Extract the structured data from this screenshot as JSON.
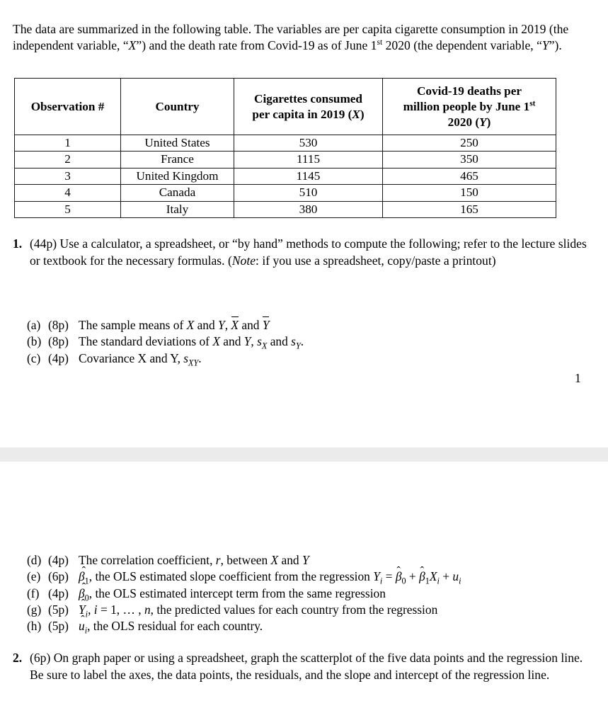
{
  "document": {
    "page_number": "1",
    "intro_paragraph": "The data are summarized in the following table.  The variables are per capita cigarette consumption in 2019 (the independent variable, “X”) and the death rate from Covid-19 as of June 1st 2020 (the dependent variable, “Y”).",
    "intro_segments": {
      "s1": "The data are summarized in the following table.  The variables are per capita cigarette consumption in 2019 (the independent variable, “",
      "var_x": "X",
      "s2": "”) and the death rate from Covid-19 as of June 1",
      "ord_st": "st",
      "s3": " 2020 (the dependent variable, “",
      "var_y": "Y",
      "s4": "”)."
    }
  },
  "table": {
    "headers": {
      "col1": "Observation #",
      "col2": "Country",
      "col3_line1": "Cigarettes consumed",
      "col3_line2_a": "per capita in 2019 (",
      "col3_var": "X",
      "col3_line2_b": ")",
      "col4_line1": "Covid-19 deaths per",
      "col4_line2": "million people by June 1",
      "col4_ord": "st",
      "col4_line3_a": "2020 (",
      "col4_var": "Y",
      "col4_line3_b": ")"
    },
    "rows": [
      {
        "obs": "1",
        "country": "United States",
        "cigarettes": "530",
        "deaths": "250"
      },
      {
        "obs": "2",
        "country": "France",
        "cigarettes": "1115",
        "deaths": "350"
      },
      {
        "obs": "3",
        "country": "United Kingdom",
        "cigarettes": "1145",
        "deaths": "465"
      },
      {
        "obs": "4",
        "country": "Canada",
        "cigarettes": "510",
        "deaths": "150"
      },
      {
        "obs": "5",
        "country": "Italy",
        "cigarettes": "380",
        "deaths": "165"
      }
    ]
  },
  "questions": {
    "q1": {
      "number": "1.",
      "text": "(44p) Use a calculator, a spreadsheet, or “by hand” methods to compute the following; refer to the lecture slides or textbook for the necessary formulas.  (Note:  if you use a spreadsheet, copy/paste a printout)",
      "seg_a": "(44p) Use a calculator, a spreadsheet, or “by hand” methods to compute the following; refer to the lecture slides or textbook for the necessary formulas.  (",
      "seg_note": "Note",
      "seg_b": ":  if you use a spreadsheet, copy/paste a printout)"
    },
    "q2": {
      "number": "2.",
      "text": "(6p) On graph paper or using a spreadsheet, graph the scatterplot of the five data points and the regression line.  Be sure to label the axes, the data points, the residuals, and the slope and intercept of the regression line."
    }
  },
  "subitems_abc": [
    {
      "label": "(a)",
      "points": "(8p)",
      "text": "The sample means of X and Y,  X̄ and Ȳ",
      "prefix": "The sample means of ",
      "v1": "X",
      "mid": " and ",
      "v2": "Y",
      "suffix": ",  ",
      "bar1": "X",
      "bar_mid": " and ",
      "bar2": "Y",
      "tail": ""
    },
    {
      "label": "(b)",
      "points": "(8p)",
      "text": "The standard deviations of X and Y,  sX and sY.",
      "prefix": "The standard deviations of ",
      "v1": "X",
      "mid": " and ",
      "v2": "Y",
      "suffix": ",  ",
      "s1": "s",
      "s1sub": "X",
      "s_mid": " and ",
      "s2": "s",
      "s2sub": "Y",
      "tail": "."
    },
    {
      "label": "(c)",
      "points": "(4p)",
      "text": "Covariance X and Y, sXY.",
      "prefix": "Covariance X and Y, ",
      "s1": "s",
      "s1sub": "XY",
      "tail": "."
    }
  ],
  "subitems_dh": [
    {
      "label": "(d)",
      "points": "(4p)",
      "text": "The correlation coefficient, r, between X and Y",
      "p1": "The correlation coefficient, ",
      "v_r": "r",
      "p2": ", between ",
      "v_x": "X",
      "p3": " and ",
      "v_y": "Y"
    },
    {
      "label": "(e)",
      "points": "(6p)",
      "text": "β̂1, the OLS estimated slope coefficient from the regression  Yi = β̂0 + β̂1Xi + ui",
      "beta": "β",
      "beta_sub": "1",
      "p1": ", the OLS estimated slope coefficient from the regression  ",
      "eq_y": "Y",
      "eq_y_sub": "i",
      "eq_eq": " = ",
      "eq_b0": "β",
      "eq_b0_sub": "0",
      "eq_plus1": " + ",
      "eq_b1": "β",
      "eq_b1_sub": "1",
      "eq_x": "X",
      "eq_x_sub": "i",
      "eq_plus2": " + ",
      "eq_u": "u",
      "eq_u_sub": "i"
    },
    {
      "label": "(f)",
      "points": "(4p)",
      "text": "β̂0, the OLS estimated intercept term from the same regression",
      "beta": "β",
      "beta_sub": "0",
      "p1": ", the OLS estimated intercept term from the same regression"
    },
    {
      "label": "(g)",
      "points": "(5p)",
      "text": "Ŷi,  i = 1, …, n, the predicted values for each country from the regression",
      "yhat": "Y",
      "yhat_sub": "i",
      "p1": ",  ",
      "v_i": "i",
      "p2": " = 1, … , ",
      "v_n": "n",
      "p3": ", the predicted values for each country from the regression"
    },
    {
      "label": "(h)",
      "points": "(5p)",
      "text": "ûi, the OLS residual for each country.",
      "uhat": "u",
      "uhat_sub": "i",
      "p1": ", the OLS residual for each country."
    }
  ],
  "colors": {
    "page_background": "#ffffff",
    "text": "#000000",
    "table_border": "#1a1a1a",
    "page_gap_band": "#ebebeb"
  }
}
